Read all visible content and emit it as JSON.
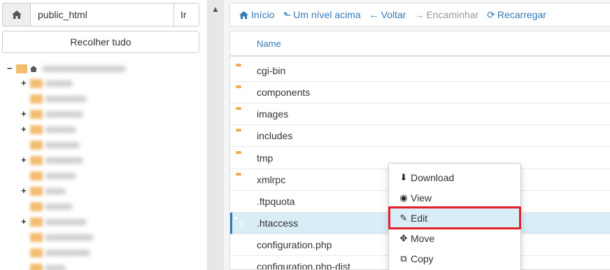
{
  "left": {
    "path_value": "public_html",
    "go_label": "Ir",
    "collapse_label": "Recolher tudo"
  },
  "toolbar": {
    "home": "Início",
    "up": "Um nível acima",
    "back": "Voltar",
    "forward": "Encaminhar",
    "reload": "Recarregar"
  },
  "table": {
    "header_name": "Name",
    "rows": [
      {
        "name": "cgi-bin",
        "type": "folder"
      },
      {
        "name": "components",
        "type": "folder"
      },
      {
        "name": "images",
        "type": "folder"
      },
      {
        "name": "includes",
        "type": "folder"
      },
      {
        "name": "tmp",
        "type": "folder"
      },
      {
        "name": "xmlrpc",
        "type": "folder"
      },
      {
        "name": ".ftpquota",
        "type": "file"
      },
      {
        "name": ".htaccess",
        "type": "file",
        "selected": true
      },
      {
        "name": "configuration.php",
        "type": "file"
      },
      {
        "name": "configuration.php-dist",
        "type": "file"
      }
    ]
  },
  "context_menu": {
    "download": "Download",
    "view": "View",
    "edit": "Edit",
    "move": "Move",
    "copy": "Copy"
  },
  "colors": {
    "link": "#337ab7",
    "folder": "#f0ad4e",
    "file": "#8e78b9",
    "selected_row": "#d9edf7",
    "highlight": "#e0202b"
  }
}
